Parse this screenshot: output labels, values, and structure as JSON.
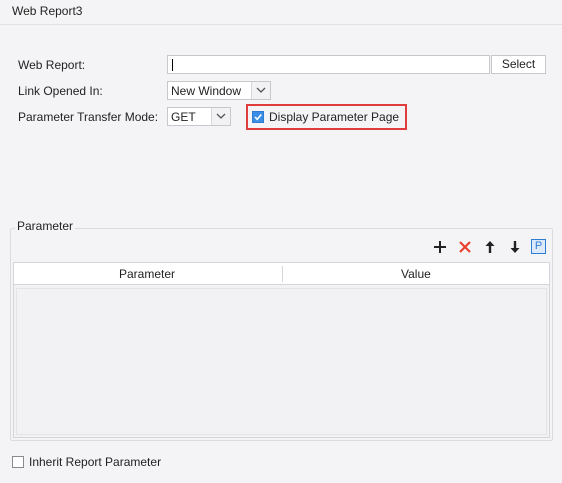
{
  "window": {
    "title": "Web Report3"
  },
  "form": {
    "web_report_label": "Web Report:",
    "web_report_value": "",
    "select_button": "Select",
    "link_opened_label": "Link Opened In:",
    "link_opened_value": "New Window",
    "transfer_mode_label": "Parameter Transfer Mode:",
    "transfer_mode_value": "GET",
    "display_param_page_label": "Display Parameter Page",
    "display_param_page_checked": true
  },
  "parameter_group": {
    "title": "Parameter",
    "toolbar": {
      "icons": [
        "add-icon",
        "delete-icon",
        "move-up-icon",
        "move-down-icon",
        "parameter-icon"
      ],
      "param_icon_letter": "P"
    },
    "table": {
      "columns": [
        "Parameter",
        "Value"
      ],
      "rows": []
    }
  },
  "footer": {
    "inherit_label": "Inherit Report Parameter",
    "inherit_checked": false
  },
  "colors": {
    "highlight": "#e03c3c",
    "check_blue": "#3a8ee6",
    "delete_red": "#e8402f",
    "param_blue": "#2f7dd1"
  }
}
